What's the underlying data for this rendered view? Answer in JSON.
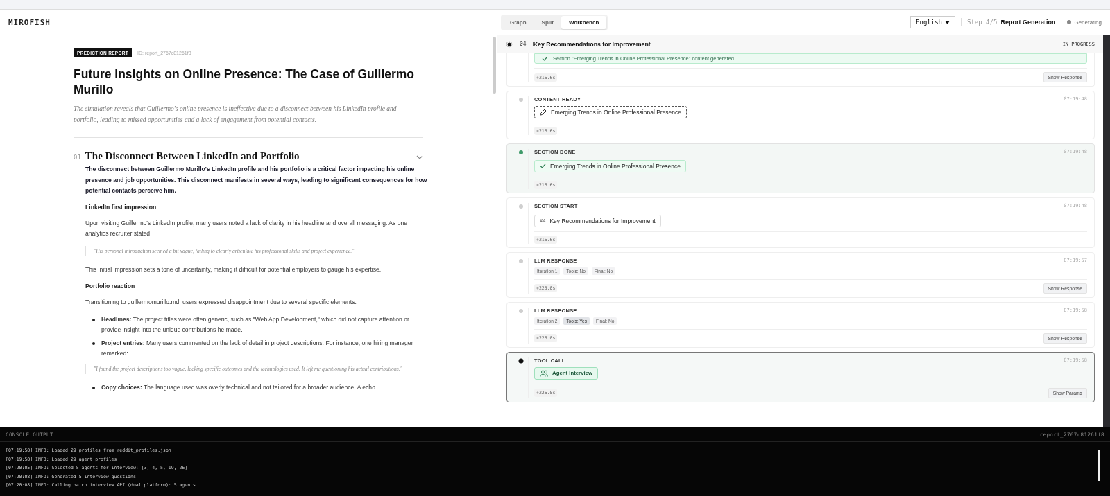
{
  "header": {
    "logo": "MIROFISH",
    "view_tabs": [
      {
        "label": "Graph",
        "selected": false
      },
      {
        "label": "Split",
        "selected": false
      },
      {
        "label": "Workbench",
        "selected": true
      }
    ],
    "language": "English",
    "step": {
      "label": "Step 4/5",
      "title": "Report Generation"
    },
    "status": "Generating"
  },
  "report": {
    "badge": "PREDICTION REPORT",
    "id": "ID: report_2767c81261f8",
    "title": "Future Insights on Online Presence: The Case of Guillermo Murillo",
    "summary": "The simulation reveals that Guillermo's online presence is ineffective due to a disconnect between his LinkedIn profile and portfolio, leading to missed opportunities and a lack of engagement from potential contacts.",
    "section": {
      "number": "01",
      "title": "The Disconnect Between LinkedIn and Portfolio",
      "expanded": true,
      "blocks": [
        {
          "kind": "lead",
          "text": "The disconnect between Guillermo Murillo's LinkedIn profile and his portfolio is a critical factor impacting his online presence and job opportunities. This disconnect manifests in several ways, leading to significant consequences for how potential contacts perceive him."
        },
        {
          "kind": "heading",
          "text": "LinkedIn first impression"
        },
        {
          "kind": "para",
          "text": "Upon visiting Guillermo's LinkedIn profile, many users noted a lack of clarity in his headline and overall messaging. As one analytics recruiter stated:"
        },
        {
          "kind": "quote",
          "text": "\"His personal introduction seemed a bit vague, failing to clearly articulate his professional skills and project experience.\""
        },
        {
          "kind": "para",
          "text": "This initial impression sets a tone of uncertainty, making it difficult for potential employers to gauge his expertise."
        },
        {
          "kind": "heading",
          "text": "Portfolio reaction"
        },
        {
          "kind": "para",
          "text": "Transitioning to guillermomurillo.md, users expressed disappointment due to several specific elements:"
        },
        {
          "kind": "list",
          "items": [
            "**Headlines:** The project titles were often generic, such as \"Web App Development,\" which did not capture attention or provide insight into the unique contributions he made.",
            "**Project entries:** Many users commented on the lack of detail in project descriptions. For instance, one hiring manager remarked:"
          ]
        },
        {
          "kind": "quote",
          "text": "\"I found the project descriptions too vague, lacking specific outcomes and the technologies used. It left me questioning his actual contributions.\""
        },
        {
          "kind": "list",
          "items": [
            "**Copy choices:** The language used was overly technical and not tailored for a broader audience. A echo"
          ]
        }
      ]
    }
  },
  "timeline": {
    "current": {
      "number": "04",
      "title": "Key Recommendations for Improvement",
      "status": "IN PROGRESS"
    },
    "events": [
      {
        "content": {
          "kind": "banner",
          "text": "Section \"Emerging Trends in Online Professional Presence\" content generated"
        },
        "elapsed": "+216.6s",
        "action": "Show Response"
      },
      {
        "done": false,
        "active": false,
        "label": "CONTENT READY",
        "time": "07:19:48",
        "content": {
          "kind": "draft",
          "text": "Emerging Trends in Online Professional Presence"
        },
        "elapsed": "+216.6s"
      },
      {
        "done": true,
        "active": false,
        "label": "SECTION DONE",
        "time": "07:19:48",
        "content": {
          "kind": "done",
          "text": "Emerging Trends in Online Professional Presence"
        },
        "elapsed": "+216.6s"
      },
      {
        "done": false,
        "active": false,
        "label": "SECTION START",
        "time": "07:19:48",
        "content": {
          "kind": "section",
          "tag": "#4",
          "text": "Key Recommendations for Improvement"
        },
        "elapsed": "+216.6s"
      },
      {
        "done": false,
        "active": false,
        "label": "LLM RESPONSE",
        "time": "07:19:57",
        "content": {
          "kind": "tags",
          "tags": [
            {
              "label": "Iteration 1",
              "highlighted": false
            },
            {
              "label": "Tools: No",
              "highlighted": false
            },
            {
              "label": "Final: No",
              "highlighted": false
            }
          ]
        },
        "elapsed": "+225.0s",
        "action": "Show Response"
      },
      {
        "done": false,
        "active": false,
        "label": "LLM RESPONSE",
        "time": "07:19:58",
        "content": {
          "kind": "tags",
          "tags": [
            {
              "label": "Iteration 2",
              "highlighted": false
            },
            {
              "label": "Tools: Yes",
              "highlighted": true
            },
            {
              "label": "Final: No",
              "highlighted": false
            }
          ]
        },
        "elapsed": "+226.0s",
        "action": "Show Response"
      },
      {
        "done": false,
        "active": true,
        "label": "TOOL CALL",
        "time": "07:19:58",
        "content": {
          "kind": "tool",
          "text": "Agent Interview"
        },
        "elapsed": "+226.0s",
        "action": "Show Params"
      }
    ]
  },
  "console": {
    "title": "CONSOLE OUTPUT",
    "id": "report_2767c81261f8",
    "lines": [
      "[07:19:58] INFO: Loaded 29 profiles from reddit_profiles.json",
      "[07:19:58] INFO: Loaded 29 agent profiles",
      "[07:20:05] INFO: Selected 5 agents for interview: [3, 4, 5, 19, 26]",
      "[07:20:08] INFO: Generated 5 interview questions",
      "[07:20:08] INFO: Calling batch interview API (dual platform): 5 agents"
    ]
  }
}
